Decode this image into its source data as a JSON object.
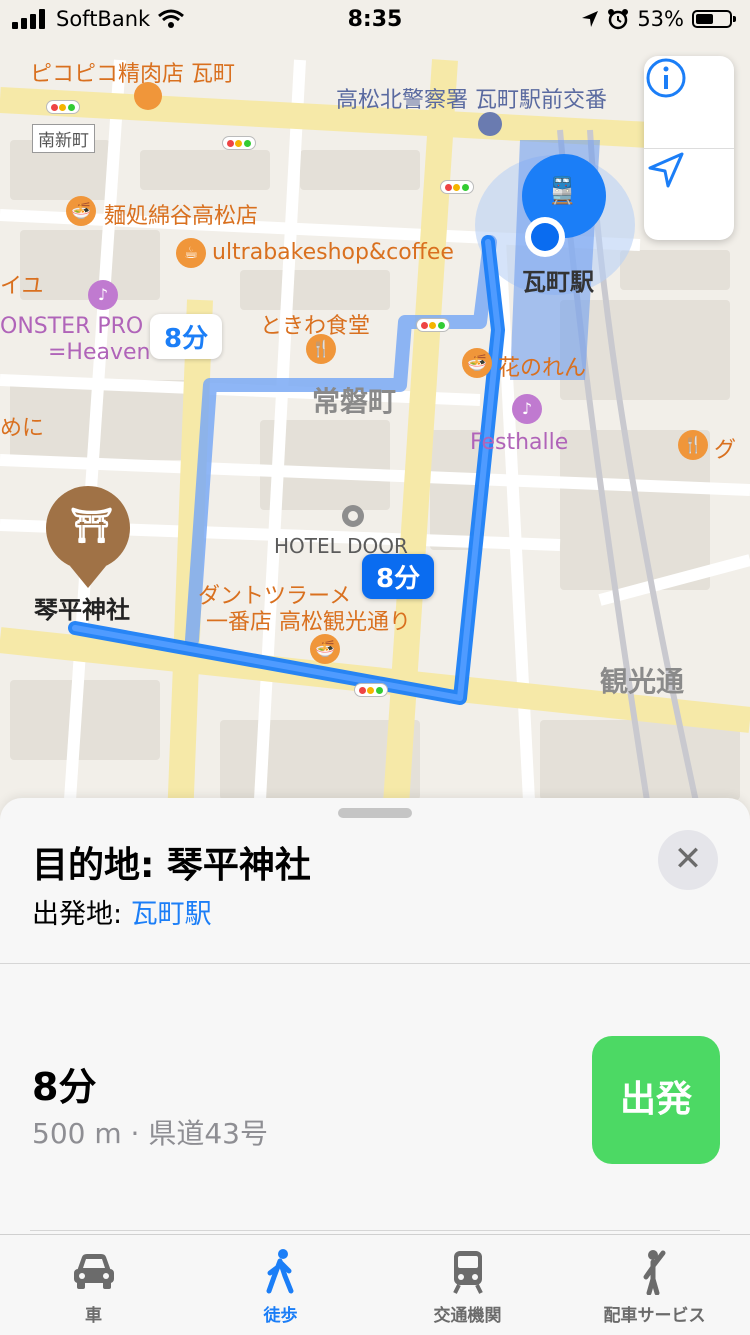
{
  "status_bar": {
    "carrier": "SoftBank",
    "time": "8:35",
    "battery": "53%",
    "battery_level": 0.53
  },
  "map": {
    "labels": {
      "pikopiko": "ピコピコ精肉店 瓦町",
      "police": "高松北警察署 瓦町駅前交番",
      "minamishinmachi": "南新町",
      "mendokoro": "麺処綿谷高松店",
      "ultrabake": "ultrabakeshop&coffee",
      "iyu": "イユ",
      "monster": "ONSTER PRO",
      "heaven": "=Heaven",
      "tokiwa_shokudo": "ときわ食堂",
      "tokiwacho": "常磐町",
      "hanoren": "花のれん",
      "festhalle": "Festhalle",
      "meni": "めに",
      "gu": "グ",
      "hotel": "HOTEL DOOR",
      "dantsu1": "ダントツラーメ",
      "dantsu2": "一番店 高松観光通り",
      "kanko": "観光通",
      "station": "瓦町駅",
      "shrine": "琴平神社"
    },
    "route_time_bubbles": [
      "8分",
      "8分"
    ]
  },
  "sheet": {
    "destination": "目的地: 琴平神社",
    "from_label": "出発地: ",
    "from_value": "瓦町駅",
    "close_label": "✕",
    "route_time": "8分",
    "route_detail": "500 m · 県道43号",
    "go_label": "出発"
  },
  "tabs": [
    {
      "label": "車",
      "icon": "car-icon"
    },
    {
      "label": "徒歩",
      "icon": "walk-icon",
      "active": true
    },
    {
      "label": "交通機関",
      "icon": "train-icon"
    },
    {
      "label": "配車サービス",
      "icon": "rideshare-icon"
    }
  ],
  "colors": {
    "accent": "#1b7ef7",
    "route": "#1b7ef7",
    "go": "#4cd964",
    "poi_orange": "#f0963a",
    "shrine": "#a07246"
  }
}
